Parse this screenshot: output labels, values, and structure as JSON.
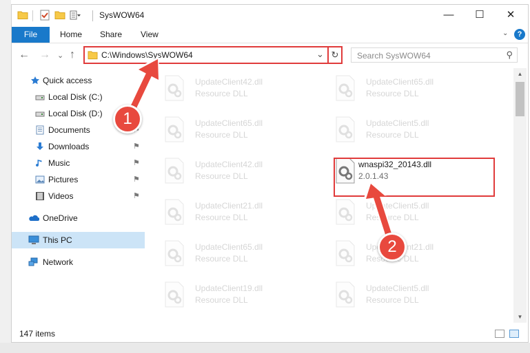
{
  "window": {
    "title": "SysWOW64",
    "minimize_glyph": "—",
    "maximize_glyph": "☐",
    "close_glyph": "✕"
  },
  "ribbon": {
    "file": "File",
    "home": "Home",
    "share": "Share",
    "view": "View",
    "help_glyph": "?",
    "expand_glyph": "⌄"
  },
  "nav": {
    "back_glyph": "←",
    "forward_glyph": "→",
    "recent_glyph": "⌄",
    "up_glyph": "↑",
    "address": "C:\\Windows\\SysWOW64",
    "address_dropdown_glyph": "⌄",
    "refresh_glyph": "↻",
    "search_placeholder": "Search SysWOW64",
    "search_glyph": "⚲"
  },
  "sidebar": {
    "items": [
      {
        "label": "Quick access",
        "icon": "star-icon",
        "pinned": false
      },
      {
        "label": "Local Disk (C:)",
        "icon": "drive-icon",
        "pinned": false
      },
      {
        "label": "Local Disk (D:)",
        "icon": "drive-icon",
        "pinned": false
      },
      {
        "label": "Documents",
        "icon": "documents-icon",
        "pinned": true
      },
      {
        "label": "Downloads",
        "icon": "downloads-icon",
        "pinned": true
      },
      {
        "label": "Music",
        "icon": "music-icon",
        "pinned": true
      },
      {
        "label": "Pictures",
        "icon": "pictures-icon",
        "pinned": true
      },
      {
        "label": "Videos",
        "icon": "videos-icon",
        "pinned": true
      },
      {
        "label": "OneDrive",
        "icon": "onedrive-icon",
        "pinned": false
      },
      {
        "label": "This PC",
        "icon": "pc-icon",
        "pinned": false
      },
      {
        "label": "Network",
        "icon": "network-icon",
        "pinned": false
      }
    ],
    "pin_glyph": "📌"
  },
  "files": [
    {
      "name": "UpdateClient42.dll",
      "type": "Resource DLL"
    },
    {
      "name": "UpdateClient65.dll",
      "type": "Resource DLL"
    },
    {
      "name": "UpdateClient65.dll",
      "type": "Resource DLL"
    },
    {
      "name": "UpdateClient5.dll",
      "type": "Resource DLL"
    },
    {
      "name": "UpdateClient42.dll",
      "type": "Resource DLL"
    },
    {
      "name": "wnaspi32_20143.dll",
      "type": "2.0.1.43"
    },
    {
      "name": "UpdateClient21.dll",
      "type": "Resource DLL"
    },
    {
      "name": "UpdateClient5.dll",
      "type": "Resource DLL"
    },
    {
      "name": "UpdateClient65.dll",
      "type": "Resource DLL"
    },
    {
      "name": "UpdateClient21.dll",
      "type": "Resource DLL"
    },
    {
      "name": "UpdateClient19.dll",
      "type": "Resource DLL"
    },
    {
      "name": "UpdateClient5.dll",
      "type": "Resource DLL"
    }
  ],
  "status": {
    "items_count": "147 items"
  },
  "annotations": {
    "step1": "1",
    "step2": "2",
    "color": "#e8493e"
  }
}
